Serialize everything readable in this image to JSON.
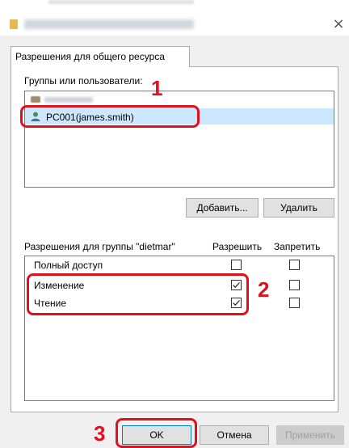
{
  "tab": {
    "label": "Разрешения для общего ресурса"
  },
  "groups": {
    "label": "Группы или пользователи:",
    "selected_user": "PC001(james.smith)"
  },
  "buttons": {
    "add": "Добавить...",
    "remove": "Удалить",
    "ok": "OK",
    "cancel": "Отмена",
    "apply": "Применить"
  },
  "permissions": {
    "label": "Разрешения для группы \"dietmar\"",
    "allow_header": "Разрешить",
    "deny_header": "Запретить",
    "rows": [
      {
        "name": "Полный доступ",
        "allow": false,
        "deny": false
      },
      {
        "name": "Изменение",
        "allow": true,
        "deny": false
      },
      {
        "name": "Чтение",
        "allow": true,
        "deny": false
      }
    ]
  },
  "annotations": {
    "step1": "1",
    "step2": "2",
    "step3": "3",
    "color": "#e0101c"
  },
  "icons": {
    "folder": "folder-icon",
    "close": "close-icon",
    "user": "user-icon",
    "group": "group-icon"
  }
}
